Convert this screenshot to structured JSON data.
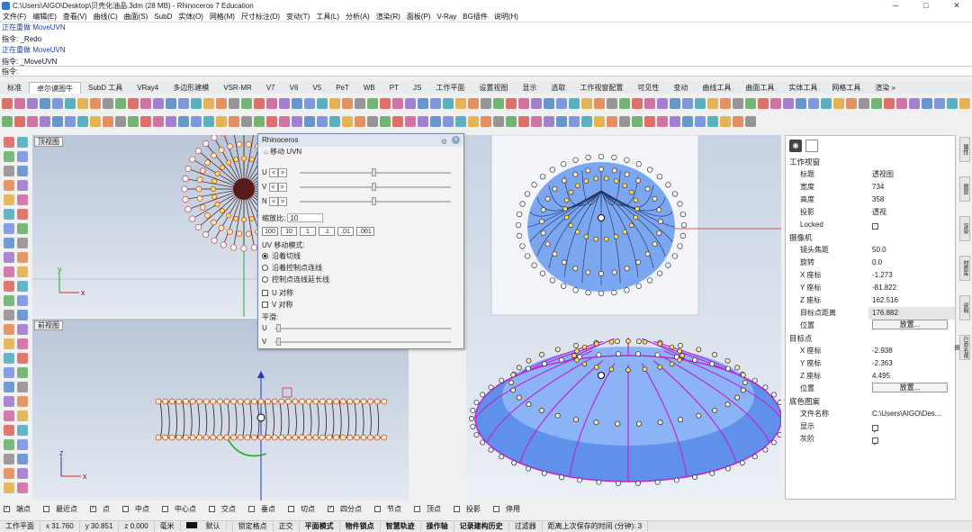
{
  "window": {
    "title": "C:\\Users\\AIGO\\Desktop\\贝壳化油品.3dm (28 MB) - Rhinoceros 7 Education",
    "controls": [
      "─",
      "□",
      "✕"
    ]
  },
  "menu": [
    "文件(F)",
    "编辑(E)",
    "查看(V)",
    "曲线(C)",
    "曲面(S)",
    "SubD",
    "实体(O)",
    "网格(M)",
    "尺寸标注(D)",
    "变动(T)",
    "工具(L)",
    "分析(A)",
    "渲染(R)",
    "面板(P)",
    "V-Ray",
    "BG插件",
    "说明(H)"
  ],
  "command_history": [
    "正在重做 MoveUVN",
    "指令: _Redo",
    "正在重做 MoveUVN",
    "指令: _MoveUVN"
  ],
  "command_prompt": "指令:",
  "tabs": [
    "标准",
    "卓尔谟图牛",
    "SubD 工具",
    "VRay4",
    "多边形建模",
    "VSR-MR",
    "V7",
    "V6",
    "V5",
    "PeT",
    "WB",
    "PT",
    "JS",
    "工作平面",
    "设置视图",
    "显示",
    "选取",
    "工作视窗配置",
    "可见性",
    "变动",
    "曲线工具",
    "曲面工具",
    "实体工具",
    "网格工具",
    "渲染 »"
  ],
  "active_tab": "卓尔谟图牛",
  "viewports": {
    "top": "顶视图",
    "front": "前视图"
  },
  "dialog": {
    "title": "Rhinoceros",
    "subtitle": "移动 UVN",
    "rows": {
      "u": "U",
      "v": "V",
      "n": "N"
    },
    "scale_label": "缩放比:",
    "scale_value": "10",
    "step_buttons": [
      "100",
      "10",
      "1",
      ".1",
      ".01",
      ".001"
    ],
    "mode_label": "UV 移动模式:",
    "modes": [
      "沿着切线",
      "沿着控制点连线",
      "控制点连线延长线"
    ],
    "selected_mode": "沿着切线",
    "sym": [
      "U 对称",
      "V 对称"
    ],
    "smooth_label": "平滑:",
    "smooth_u": "U",
    "smooth_v": "V"
  },
  "props": {
    "section_viewport": "工作视窗",
    "rows_viewport": [
      [
        "标题",
        "透视图"
      ],
      [
        "宽度",
        "734"
      ],
      [
        "高度",
        "358"
      ],
      [
        "投影",
        "透视"
      ],
      [
        "Locked",
        ""
      ]
    ],
    "section_camera": "摄像机",
    "rows_camera": [
      [
        "镜头焦距",
        "50.0"
      ],
      [
        "旋转",
        "0.0"
      ],
      [
        "X 座标",
        "-1.273"
      ],
      [
        "Y 座标",
        "-81.822"
      ],
      [
        "Z 座标",
        "162.516"
      ],
      [
        "目标点距离",
        "176.882"
      ],
      [
        "位置",
        "放置..."
      ]
    ],
    "section_target": "目标点",
    "rows_target": [
      [
        "X 座标",
        "-2.938"
      ],
      [
        "Y 座标",
        "-2.363"
      ],
      [
        "Z 座标",
        "4.495"
      ],
      [
        "位置",
        "放置..."
      ]
    ],
    "section_bg": "底色图案",
    "rows_bg": [
      [
        "文件名称",
        "C:\\Users\\AIGO\\Des..."
      ],
      [
        "显示",
        ""
      ],
      [
        "灰阶",
        ""
      ]
    ]
  },
  "side_tabs": [
    "属性",
    "图层",
    "渲染",
    "材质库",
    "说明",
    "已命名视图"
  ],
  "snaps": [
    {
      "label": "端点",
      "on": true
    },
    {
      "label": "最近点",
      "on": false
    },
    {
      "label": "点",
      "on": true
    },
    {
      "label": "中点",
      "on": false
    },
    {
      "label": "中心点",
      "on": false
    },
    {
      "label": "交点",
      "on": false
    },
    {
      "label": "垂点",
      "on": false
    },
    {
      "label": "切点",
      "on": false
    },
    {
      "label": "四分点",
      "on": true
    },
    {
      "label": "节点",
      "on": false
    },
    {
      "label": "顶点",
      "on": false
    },
    {
      "label": "投影",
      "on": false
    },
    {
      "label": "停用",
      "on": false
    }
  ],
  "status": {
    "plane": "工作平面",
    "x": "x 31.760",
    "y": "y 30.851",
    "z": "z 0.000",
    "unit": "毫米",
    "layer": "默认",
    "items": [
      "锁定格点",
      "正交",
      "平面模式",
      "物件锁点",
      "智慧轨迹",
      "操作轴",
      "记录建构历史",
      "过滤器",
      "距离上次保存的时间 (分钟): 3"
    ]
  },
  "colors": {
    "viewport_top": "#b9c6d8",
    "surface_blue": "#6e9ef0",
    "cp_white": "#ffffff",
    "curve_magenta": "#c026d3",
    "point_yellow": "#ffe04a"
  }
}
